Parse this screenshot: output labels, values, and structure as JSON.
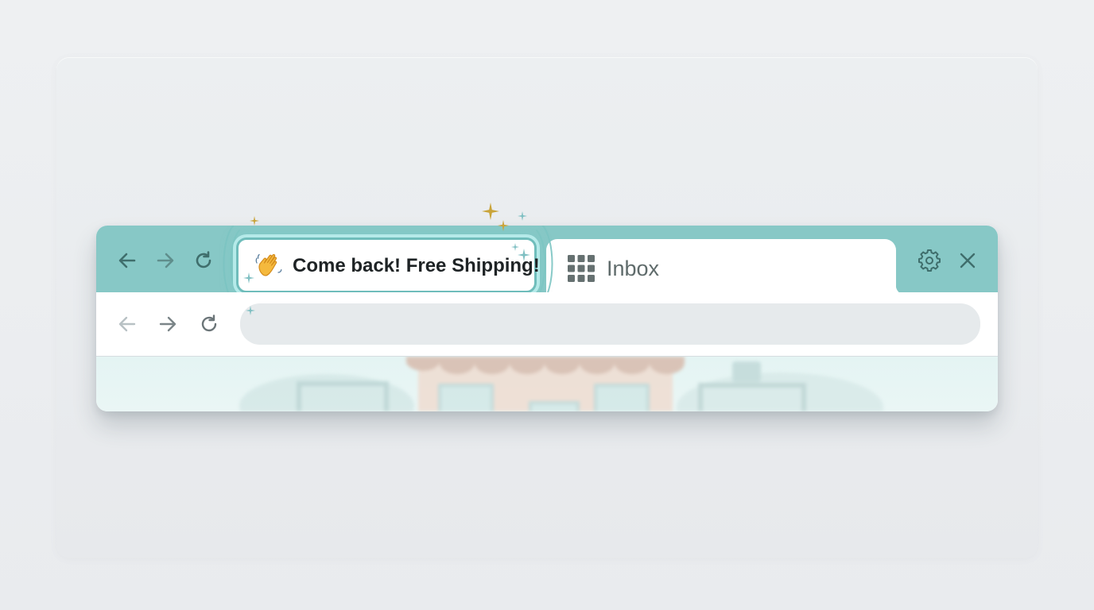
{
  "browser": {
    "tabs": [
      {
        "label": "Come back! Free Shipping!",
        "icon": "waving-hand-icon",
        "state": "attention-highlighted"
      },
      {
        "label": "Inbox",
        "icon": "grid-apps-icon",
        "state": "inactive"
      }
    ],
    "tabstrip_nav": [
      "back-arrow-icon",
      "forward-arrow-icon",
      "reload-icon"
    ],
    "toolbar_nav": [
      "back-arrow-icon",
      "forward-arrow-icon",
      "reload-icon"
    ],
    "window_controls": [
      "gear-icon",
      "close-icon"
    ],
    "address_bar": {
      "value": "",
      "placeholder": ""
    }
  },
  "colors": {
    "tabstrip": "#87c8c6",
    "highlight_border": "#6fbdbb",
    "omnibox": "#e6eaec",
    "icon": "#4a6e6d",
    "sparkle_gold": "#c9a43a",
    "sparkle_teal": "#7fbfc2"
  }
}
